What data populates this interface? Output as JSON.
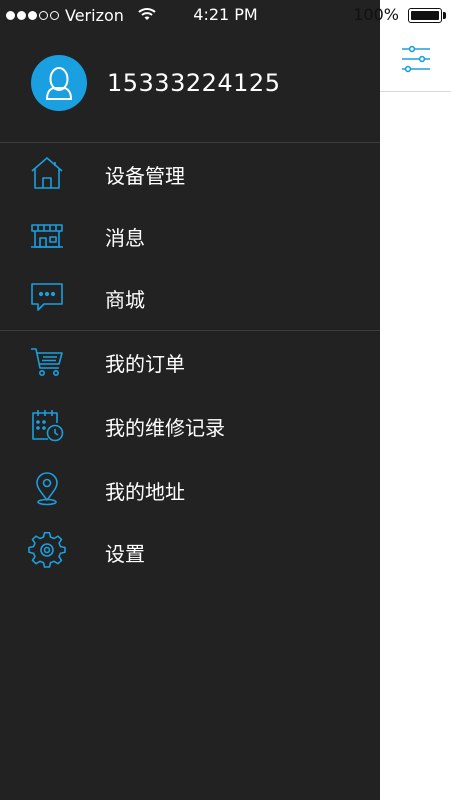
{
  "status_bar": {
    "signal_full": 3,
    "signal_empty": 2,
    "carrier": "Verizon",
    "time": "4:21 PM",
    "battery": "100%"
  },
  "profile": {
    "phone": "15333224125"
  },
  "menu": {
    "items": [
      {
        "label": "设备管理",
        "icon": "home-icon"
      },
      {
        "label": "消息",
        "icon": "storefront-icon"
      },
      {
        "label": "商城",
        "icon": "chat-bubble-icon"
      },
      {
        "label": "我的订单",
        "icon": "cart-icon"
      },
      {
        "label": "我的维修记录",
        "icon": "calendar-clock-icon"
      },
      {
        "label": "我的地址",
        "icon": "location-pin-icon"
      },
      {
        "label": "设置",
        "icon": "gear-icon"
      }
    ]
  },
  "colors": {
    "drawer_bg": "#222222",
    "accent": "#1a9fe0",
    "divider": "#3c3c3c"
  }
}
